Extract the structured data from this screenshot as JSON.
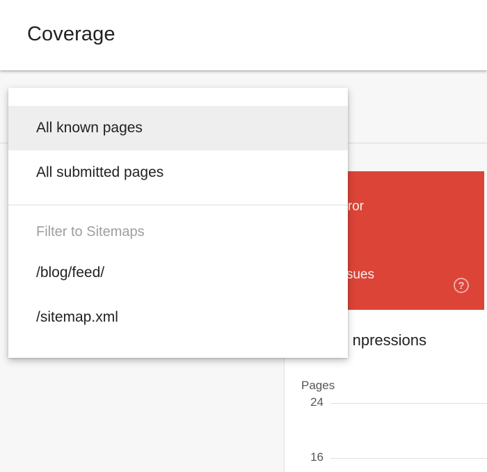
{
  "header": {
    "title": "Coverage"
  },
  "menu": {
    "items": [
      {
        "label": "All known pages",
        "selected": true
      },
      {
        "label": "All submitted pages",
        "selected": false
      }
    ],
    "group_label": "Filter to Sitemaps",
    "sitemaps": [
      {
        "label": "/blog/feed/"
      },
      {
        "label": "/sitemap.xml"
      }
    ]
  },
  "error_card": {
    "label_partial": "ror",
    "sub_partial": "sues",
    "help_icon": "help-circle-icon",
    "color": "#db4437"
  },
  "chart_card": {
    "toggle_partial": "npressions",
    "y_axis_title": "Pages",
    "ticks": [
      "24",
      "16"
    ]
  }
}
